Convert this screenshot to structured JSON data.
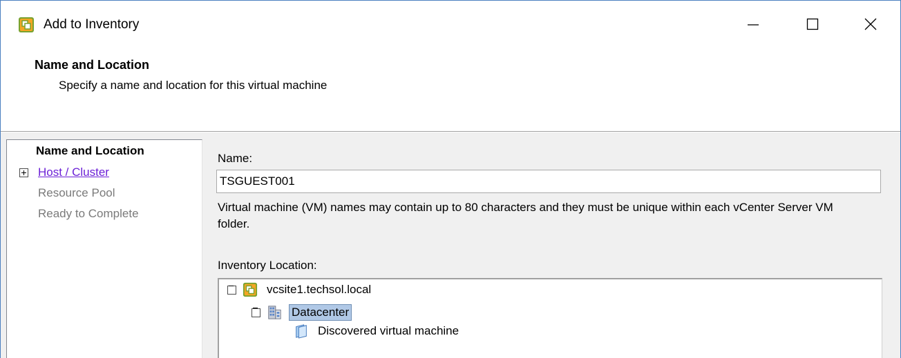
{
  "window": {
    "title": "Add to Inventory",
    "icon": "vsphere-client-icon",
    "controls": [
      "minimize-icon",
      "maximize-icon",
      "close-icon"
    ]
  },
  "header": {
    "title": "Name and Location",
    "subtitle": "Specify a name and location for this virtual machine"
  },
  "steps": [
    {
      "label": "Name and Location",
      "state": "current"
    },
    {
      "label": "Host / Cluster",
      "state": "link"
    },
    {
      "label": "Resource Pool",
      "state": "disabled"
    },
    {
      "label": "Ready to Complete",
      "state": "disabled"
    }
  ],
  "form": {
    "name_label": "Name:",
    "name_value": "TSGUEST001",
    "help_text": "Virtual machine (VM) names may contain up to 80 characters and they must be unique within each vCenter Server VM folder.",
    "inventory_label": "Inventory Location:"
  },
  "tree": [
    {
      "label": "vcsite1.techsol.local",
      "icon": "vcenter-icon",
      "expanded": true
    },
    {
      "label": "Datacenter",
      "icon": "datacenter-icon",
      "expanded": true,
      "selected": true
    },
    {
      "label": "Discovered virtual machine",
      "icon": "folder-icon"
    }
  ],
  "colors": {
    "link": "#6b1fd6",
    "selection": "#b0c8e6",
    "window_border": "#4a7fc0"
  }
}
